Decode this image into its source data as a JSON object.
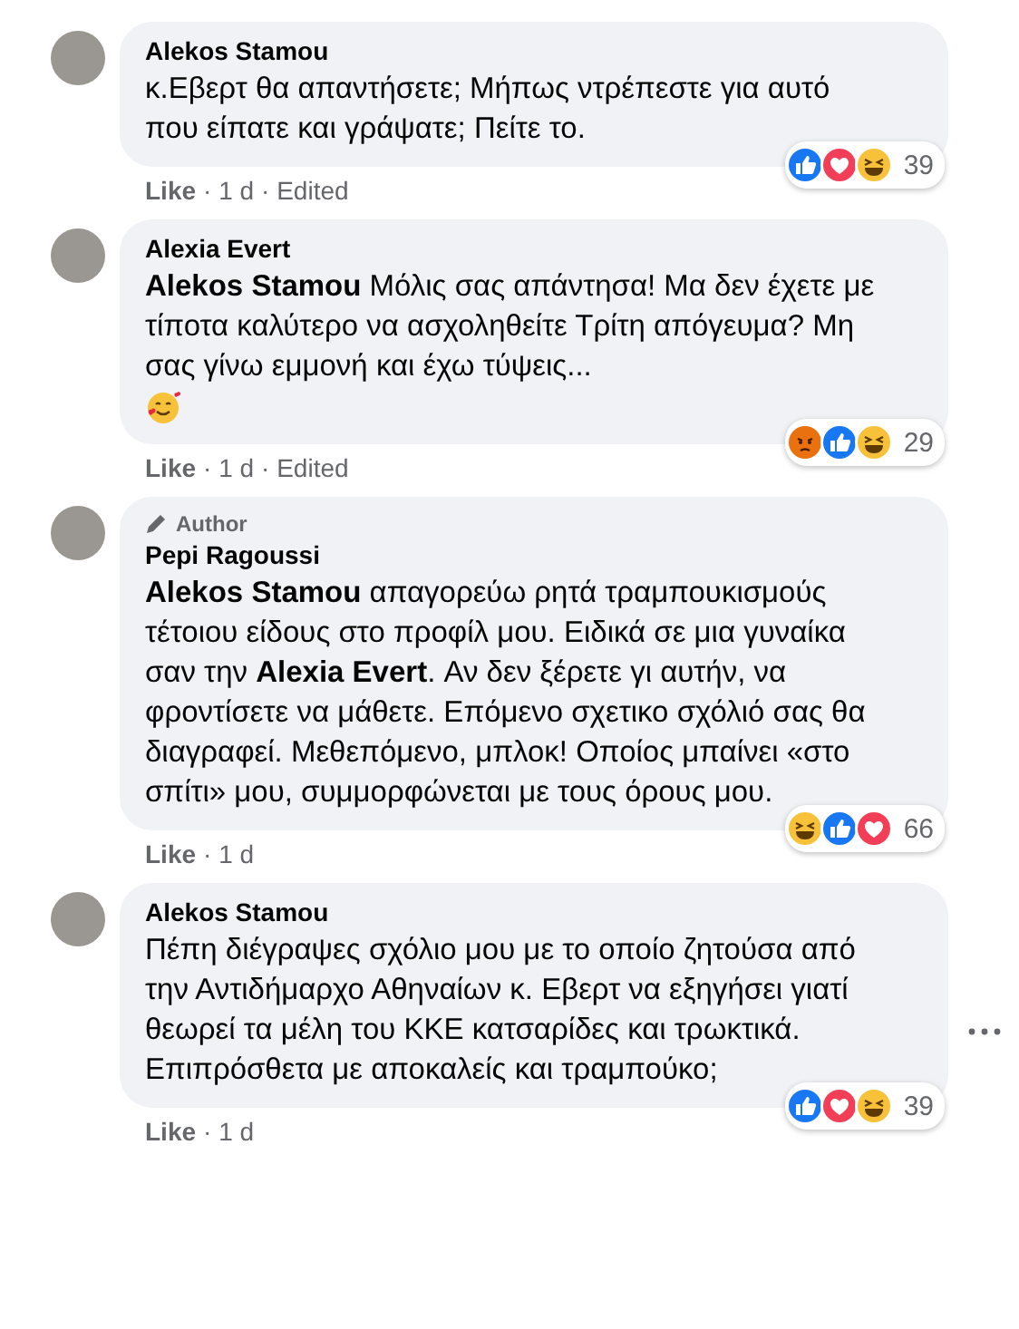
{
  "separator": "·",
  "comments": [
    {
      "author": "Alekos Stamou",
      "text": "κ.Εβερτ θα απαντήσετε; Μήπως ντρέπεστε για αυτό που είπατε και γράψατε; Πείτε το.",
      "emoji": false,
      "like_label": "Like",
      "meta": [
        "1 d",
        "Edited"
      ],
      "reactions": [
        {
          "kind": "like"
        },
        {
          "kind": "love"
        },
        {
          "kind": "haha"
        }
      ],
      "reaction_count": "39",
      "has_menu": false
    },
    {
      "author": "Alexia Evert",
      "text": "**Alekos Stamou** Μόλις σας απάντησα! Μα δεν έχετε με τίποτα καλύτερο να ασχοληθείτε Τρίτη απόγευμα? Μη σας γίνω εμμονή και έχω τύψεις...",
      "emoji": true,
      "like_label": "Like",
      "meta": [
        "1 d",
        "Edited"
      ],
      "reactions": [
        {
          "kind": "angry"
        },
        {
          "kind": "like"
        },
        {
          "kind": "haha"
        }
      ],
      "reaction_count": "29",
      "has_menu": false
    },
    {
      "author": "Pepi Ragoussi",
      "badge": "Author",
      "text": "**Alekos Stamou** απαγορεύω ρητά τραμπουκισμούς τέτοιου είδους στο προφίλ μου. Ειδικά σε μια γυναίκα σαν την **Alexia Evert**. Αν δεν ξέρετε γι αυτήν, να φροντίσετε να μάθετε. Επόμενο σχετικο σχόλιό σας θα διαγραφεί. Μεθεπόμενο, μπλοκ! Οποίος μπαίνει «στο σπίτι» μου, συμμορφώνεται με τους όρους μου.",
      "emoji": false,
      "like_label": "Like",
      "meta": [
        "1 d"
      ],
      "reactions": [
        {
          "kind": "haha"
        },
        {
          "kind": "like"
        },
        {
          "kind": "love"
        }
      ],
      "reaction_count": "66",
      "has_menu": false
    },
    {
      "author": "Alekos Stamou",
      "text": "Πέπη διέγραψες σχόλιο μου με το οποίο ζητούσα από την Αντιδήμαρχο Αθηναίων κ. Εβερτ να εξηγήσει γιατί θεωρεί τα μέλη του ΚΚΕ κατσαρίδες και τρωκτικά.\nΕπιπρόσθετα με αποκαλείς και τραμπούκο;",
      "emoji": false,
      "like_label": "Like",
      "meta": [
        "1 d"
      ],
      "reactions": [
        {
          "kind": "like"
        },
        {
          "kind": "love"
        },
        {
          "kind": "haha"
        }
      ],
      "reaction_count": "39",
      "has_menu": true
    }
  ]
}
